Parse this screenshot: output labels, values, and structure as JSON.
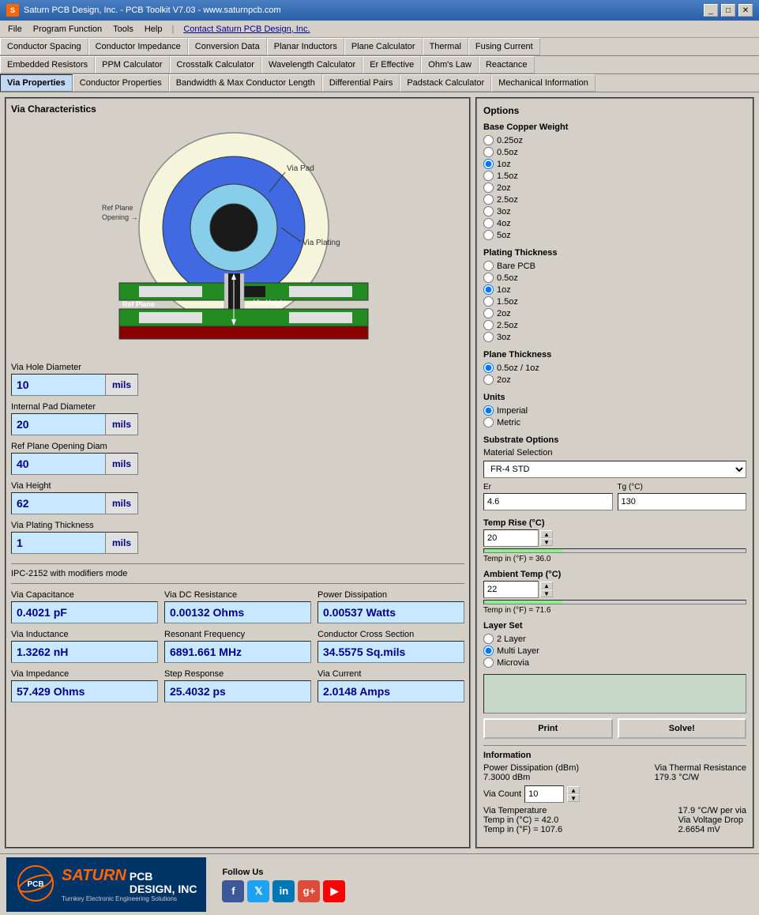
{
  "titlebar": {
    "title": "Saturn PCB Design, Inc. - PCB Toolkit V7.03 - www.saturnpcb.com",
    "icon": "S"
  },
  "menubar": {
    "items": [
      "File",
      "Program Function",
      "Tools",
      "Help"
    ],
    "contact": "Contact Saturn PCB Design, Inc."
  },
  "toolbar": {
    "row1": [
      "Conductor Spacing",
      "Conductor Impedance",
      "Conversion Data",
      "Planar Inductors",
      "Plane Calculator",
      "Thermal",
      "Fusing Current"
    ],
    "row2": [
      "Embedded Resistors",
      "PPM Calculator",
      "Crosstalk Calculator",
      "Wavelength Calculator",
      "Er Effective",
      "Ohm's Law",
      "Reactance"
    ],
    "row3": [
      "Via Properties",
      "Conductor Properties",
      "Bandwidth & Max Conductor Length",
      "Differential Pairs",
      "Padstack Calculator",
      "Mechanical Information"
    ]
  },
  "panel": {
    "title": "Via Characteristics"
  },
  "inputs": {
    "via_hole_diameter": {
      "label": "Via Hole Diameter",
      "value": "10",
      "unit": "mils"
    },
    "internal_pad_diameter": {
      "label": "Internal Pad Diameter",
      "value": "20",
      "unit": "mils"
    },
    "ref_plane_opening": {
      "label": "Ref Plane Opening Diam",
      "value": "40",
      "unit": "mils"
    },
    "via_height": {
      "label": "Via Height",
      "value": "62",
      "unit": "mils"
    },
    "via_plating_thickness": {
      "label": "Via Plating Thickness",
      "value": "1",
      "unit": "mils"
    }
  },
  "ipc_text": "IPC-2152 with modifiers mode",
  "outputs": {
    "via_capacitance": {
      "label": "Via Capacitance",
      "value": "0.4021 pF"
    },
    "via_dc_resistance": {
      "label": "Via DC Resistance",
      "value": "0.00132 Ohms"
    },
    "power_dissipation": {
      "label": "Power Dissipation",
      "value": "0.00537 Watts"
    },
    "via_inductance": {
      "label": "Via Inductance",
      "value": "1.3262 nH"
    },
    "resonant_frequency": {
      "label": "Resonant Frequency",
      "value": "6891.661 MHz"
    },
    "conductor_cross_section": {
      "label": "Conductor Cross Section",
      "value": "34.5575 Sq.mils"
    },
    "via_impedance": {
      "label": "Via Impedance",
      "value": "57.429 Ohms"
    },
    "step_response": {
      "label": "Step Response",
      "value": "25.4032 ps"
    },
    "via_current": {
      "label": "Via Current",
      "value": "2.0148 Amps"
    }
  },
  "options": {
    "title": "Options",
    "base_copper_weight": {
      "label": "Base Copper Weight",
      "options": [
        "0.25oz",
        "0.5oz",
        "1oz",
        "1.5oz",
        "2oz",
        "2.5oz",
        "3oz",
        "4oz",
        "5oz"
      ],
      "selected": "1oz"
    },
    "plating_thickness": {
      "label": "Plating Thickness",
      "options": [
        "Bare PCB",
        "0.5oz",
        "1oz",
        "1.5oz",
        "2oz",
        "2.5oz",
        "3oz"
      ],
      "selected": "1oz"
    },
    "plane_thickness": {
      "label": "Plane Thickness",
      "options": [
        "0.5oz / 1oz",
        "2oz"
      ],
      "selected": "0.5oz / 1oz"
    },
    "units": {
      "label": "Units",
      "options": [
        "Imperial",
        "Metric"
      ],
      "selected": "Imperial"
    },
    "substrate": {
      "label": "Substrate Options",
      "material_label": "Material Selection",
      "material_value": "FR-4 STD",
      "er_label": "Er",
      "er_value": "4.6",
      "tg_label": "Tg (°C)",
      "tg_value": "130"
    },
    "temp_rise": {
      "label": "Temp Rise (°C)",
      "value": "20",
      "temp_text": "Temp in (°F) = 36.0"
    },
    "ambient_temp": {
      "label": "Ambient Temp (°C)",
      "value": "22",
      "temp_text": "Temp in (°F) = 71.6"
    },
    "layer_set": {
      "label": "Layer Set",
      "options": [
        "2 Layer",
        "Multi Layer",
        "Microvia"
      ],
      "selected": "Multi Layer"
    }
  },
  "information": {
    "label": "Information",
    "power_dissipation_label": "Power Dissipation (dBm)",
    "power_dissipation_value": "7.3000 dBm",
    "via_thermal_resistance_label": "Via Thermal Resistance",
    "via_thermal_resistance_value": "179.3 °C/W",
    "via_count_label": "Via Count",
    "via_count_value": "10",
    "via_temp_label": "Via Temperature",
    "via_temp_c": "Temp in (°C) = 42.0",
    "via_temp_f": "Temp in (°F) = 107.6",
    "via_per_label": "17.9 °C/W per via",
    "via_voltage_drop_label": "Via Voltage Drop",
    "via_voltage_drop_value": "2.6654 mV"
  },
  "buttons": {
    "print": "Print",
    "solve": "Solve!"
  },
  "logo": {
    "saturn": "SATURN",
    "pcb": "PCB",
    "design": "DESIGN, INC",
    "tagline": "Turnkey Electronic Engineering Solutions",
    "follow_us": "Follow Us"
  },
  "diagram_labels": {
    "via_pad": "Via Pad",
    "ref_plane_opening": "Ref Plane\nOpening →",
    "ref_plane": "Ref Plane",
    "via_plating": "Via Plating",
    "via_height": "Via Height"
  }
}
